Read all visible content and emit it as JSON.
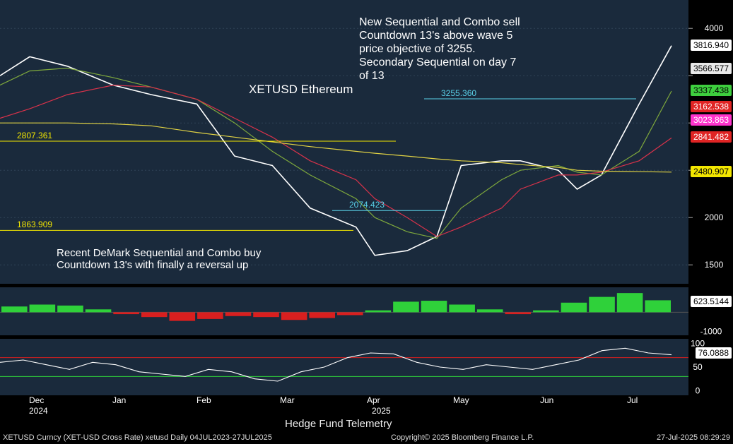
{
  "title": "XETUSD Ethereum",
  "annotations": {
    "sell": "New Sequential and Combo sell Countdown 13's  above wave 5 price objective of 3255. Secondary Sequential on day 7 of 13",
    "buy": "Recent DeMark Sequential and Combo buy Countdown 13's with finally a reversal up"
  },
  "level_labels": [
    {
      "text": "2807.361",
      "value": 2807.361
    },
    {
      "text": "3255.360",
      "value": 3255.36
    },
    {
      "text": "2074.423",
      "value": 2074.423
    },
    {
      "text": "1863.909",
      "value": 1863.909
    }
  ],
  "price_tags": [
    {
      "text": "3816.940",
      "value": 3816.94,
      "color": "#ffffff"
    },
    {
      "text": "3566.577",
      "value": 3566.577,
      "color": "#e8e8e8"
    },
    {
      "text": "3337.438",
      "value": 3337.438,
      "color": "#3ecf3e"
    },
    {
      "text": "3162.538",
      "value": 3162.538,
      "color": "#e02424"
    },
    {
      "text": "3023.863",
      "value": 3023.863,
      "color": "#ff33cc"
    },
    {
      "text": "2841.482",
      "value": 2841.482,
      "color": "#e02424"
    },
    {
      "text": "2480.907",
      "value": 2480.907,
      "color": "#f2e600"
    }
  ],
  "osc_tag": {
    "text": "623.5144"
  },
  "rsi_tag": {
    "text": "76.0888"
  },
  "x_months": [
    "Dec",
    "Jan",
    "Feb",
    "Mar",
    "Apr",
    "May",
    "Jun",
    "Jul"
  ],
  "x_years": [
    "2024",
    "2025"
  ],
  "footer": {
    "left": "XETUSD Curncy (XET-USD Cross Rate) xetusd  Daily 04JUL2023-27JUL2025",
    "center": "Hedge Fund Telemetry",
    "copyright": "Copyright© 2025 Bloomberg Finance L.P.",
    "timestamp": "27-Jul-2025 08:29:29"
  },
  "chart_data": [
    {
      "type": "ohlc-line",
      "title": "XETUSD Ethereum",
      "ylim": [
        1300,
        4300
      ],
      "yticks": [
        1500,
        2000,
        2500,
        3000,
        3500,
        4000
      ],
      "ytick_labels": [
        "1500",
        "2000",
        "",
        "",
        "",
        "4000"
      ],
      "x": [
        "2024-11-20",
        "2024-12-01",
        "2024-12-15",
        "2025-01-01",
        "2025-01-15",
        "2025-02-01",
        "2025-02-15",
        "2025-03-01",
        "2025-03-15",
        "2025-04-01",
        "2025-04-08",
        "2025-04-20",
        "2025-05-01",
        "2025-05-10",
        "2025-05-25",
        "2025-06-01",
        "2025-06-15",
        "2025-06-22",
        "2025-07-01",
        "2025-07-15",
        "2025-07-27"
      ],
      "series": [
        {
          "values": [
            3500,
            3700,
            3600,
            3400,
            3300,
            3200,
            2650,
            2550,
            2100,
            1900,
            1600,
            1650,
            1800,
            2550,
            2600,
            2600,
            2500,
            2300,
            2450,
            3200,
            3816.94
          ]
        },
        {
          "values": [
            3400,
            3550,
            3580,
            3480,
            3380,
            3250,
            3000,
            2700,
            2450,
            2200,
            2000,
            1850,
            1780,
            2100,
            2400,
            2500,
            2550,
            2480,
            2450,
            2700,
            3337.438
          ]
        },
        {
          "values": [
            3050,
            3150,
            3300,
            3400,
            3380,
            3250,
            3050,
            2850,
            2600,
            2400,
            2200,
            2000,
            1800,
            1900,
            2100,
            2300,
            2450,
            2450,
            2480,
            2600,
            2841.482
          ]
        },
        {
          "values": [
            3000,
            3000,
            3000,
            2990,
            2970,
            2900,
            2850,
            2800,
            2750,
            2700,
            2680,
            2650,
            2620,
            2600,
            2580,
            2560,
            2530,
            2500,
            2490,
            2485,
            2480.907
          ]
        }
      ]
    },
    {
      "type": "bar",
      "ylim": [
        -1200,
        1300
      ],
      "ytick_labels": [
        "-1000"
      ],
      "values": [
        300,
        400,
        350,
        150,
        -100,
        -250,
        -450,
        -350,
        -200,
        -250,
        -400,
        -300,
        -150,
        100,
        550,
        600,
        400,
        150,
        -100,
        100,
        500,
        800,
        1000,
        623.5144
      ]
    },
    {
      "type": "line",
      "ylim": [
        -10,
        110
      ],
      "yticks": [
        0,
        50,
        100
      ],
      "ytick_labels": [
        "0",
        "50",
        "100"
      ],
      "values": [
        60,
        65,
        55,
        45,
        60,
        55,
        40,
        35,
        30,
        45,
        40,
        25,
        20,
        40,
        50,
        70,
        80,
        78,
        60,
        50,
        45,
        55,
        50,
        45,
        55,
        65,
        85,
        90,
        80,
        76.0888
      ]
    }
  ]
}
